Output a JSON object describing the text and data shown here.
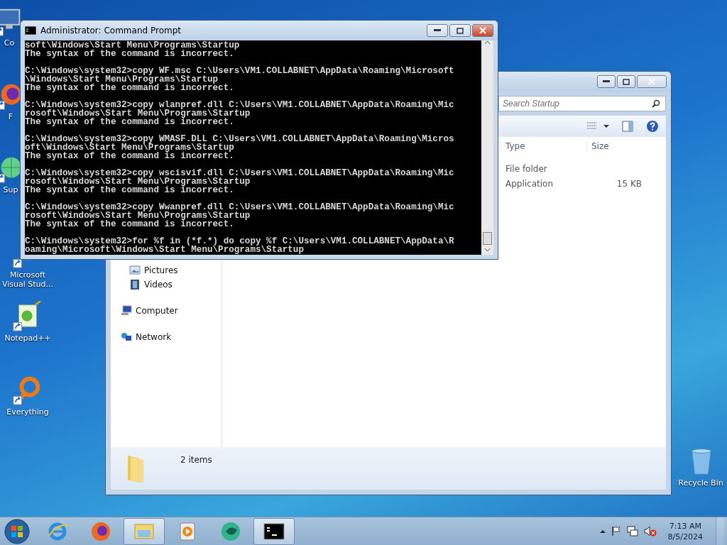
{
  "desktop_icons": [
    {
      "kind": "computer",
      "label": "Co"
    },
    {
      "kind": "firefox",
      "label": "F"
    },
    {
      "kind": "globe",
      "label": "Sup"
    },
    {
      "kind": "vs",
      "label": "Microsoft Visual Stud..."
    },
    {
      "kind": "notepad",
      "label": "Notepad++"
    },
    {
      "kind": "everything",
      "label": "Everything"
    },
    {
      "kind": "recycle",
      "label": "Recycle Bin"
    }
  ],
  "explorer": {
    "search": {
      "placeholder": "Search Startup"
    },
    "columns": [
      "Type",
      "Size"
    ],
    "rows": [
      {
        "type": "File folder"
      },
      {
        "type": "Application",
        "size": "15 KB"
      }
    ],
    "nav_pane": [
      {
        "children": [
          {
            "kind": "pictures",
            "label": "Pictures"
          },
          {
            "kind": "videos",
            "label": "Videos"
          }
        ]
      },
      {
        "kind": "computer",
        "label": "Computer"
      },
      {
        "kind": "network",
        "label": "Network"
      }
    ],
    "status": "2 items"
  },
  "command_prompt": {
    "title": "Administrator: Command Prompt",
    "blocks": [
      [
        "soft\\Windows\\Start Menu\\Programs\\Startup",
        "The syntax of the command is incorrect."
      ],
      [
        "C:\\Windows\\system32>copy WF.msc C:\\Users\\VM1.COLLABNET\\AppData\\Roaming\\Microsoft",
        "\\Windows\\Start Menu\\Programs\\Startup",
        "The syntax of the command is incorrect."
      ],
      [
        "C:\\Windows\\system32>copy wlanpref.dll C:\\Users\\VM1.COLLABNET\\AppData\\Roaming\\Mic",
        "rosoft\\Windows\\Start Menu\\Programs\\Startup",
        "The syntax of the command is incorrect."
      ],
      [
        "C:\\Windows\\system32>copy WMASF.DLL C:\\Users\\VM1.COLLABNET\\AppData\\Roaming\\Micros",
        "oft\\Windows\\Start Menu\\Programs\\Startup",
        "The syntax of the command is incorrect."
      ],
      [
        "C:\\Windows\\system32>copy wscisvif.dll C:\\Users\\VM1.COLLABNET\\AppData\\Roaming\\Mic",
        "rosoft\\Windows\\Start Menu\\Programs\\Startup",
        "The syntax of the command is incorrect."
      ],
      [
        "C:\\Windows\\system32>copy Wwanpref.dll C:\\Users\\VM1.COLLABNET\\AppData\\Roaming\\Mic",
        "rosoft\\Windows\\Start Menu\\Programs\\Startup",
        "The syntax of the command is incorrect."
      ],
      [
        "C:\\Windows\\system32>for %f in (*f.*) do copy %f C:\\Users\\VM1.COLLABNET\\AppData\\R",
        "oaming\\Microsoft\\Windows\\Start Menu\\Programs\\Startup"
      ]
    ]
  },
  "taskbar": {
    "items": [
      {
        "kind": "ie",
        "running": false
      },
      {
        "kind": "firefox",
        "running": false
      },
      {
        "kind": "explorer",
        "running": true
      },
      {
        "kind": "media",
        "running": false
      },
      {
        "kind": "green",
        "running": false
      },
      {
        "kind": "cmd",
        "running": true
      }
    ],
    "clock": {
      "time": "7:13 AM",
      "date": "8/5/2024"
    },
    "volume_muted": true
  }
}
